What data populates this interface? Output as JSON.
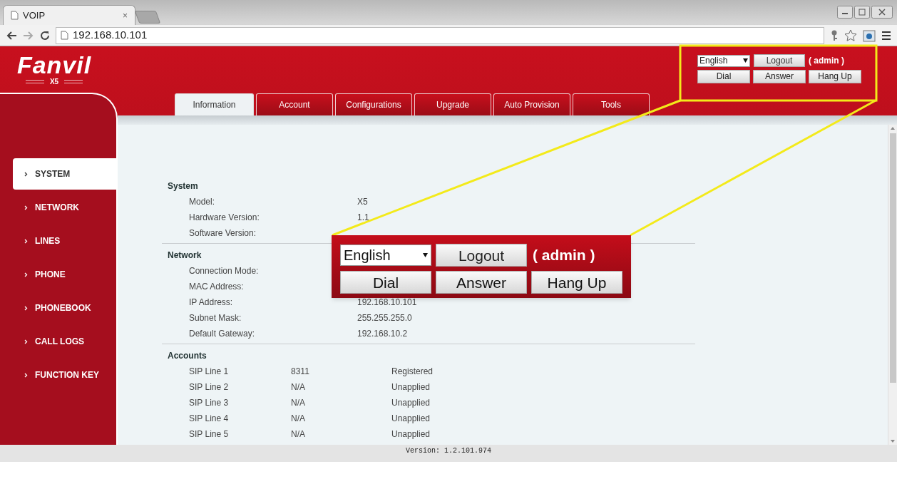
{
  "browser": {
    "tab_title": "VOIP",
    "tab_close": "×",
    "url": "192.168.10.101"
  },
  "header": {
    "logo": "Fanvil",
    "model": "X5",
    "language": "English",
    "logout": "Logout",
    "user": "( admin )",
    "buttons": [
      "Dial",
      "Answer",
      "Hang Up"
    ]
  },
  "tabs": [
    {
      "label": "Information",
      "selected": true
    },
    {
      "label": "Account",
      "selected": false
    },
    {
      "label": "Configurations",
      "selected": false
    },
    {
      "label": "Upgrade",
      "selected": false
    },
    {
      "label": "Auto Provision",
      "selected": false
    },
    {
      "label": "Tools",
      "selected": false
    }
  ],
  "sidebar": {
    "items": [
      {
        "label": "SYSTEM",
        "selected": true
      },
      {
        "label": "NETWORK",
        "selected": false
      },
      {
        "label": "LINES",
        "selected": false
      },
      {
        "label": "PHONE",
        "selected": false
      },
      {
        "label": "PHONEBOOK",
        "selected": false
      },
      {
        "label": "CALL LOGS",
        "selected": false
      },
      {
        "label": "FUNCTION KEY",
        "selected": false
      }
    ]
  },
  "sections": [
    {
      "title": "System",
      "rows": [
        {
          "label": "Model:",
          "value": "X5"
        },
        {
          "label": "Hardware Version:",
          "value": "1.1"
        },
        {
          "label": "Software Version:"
        }
      ]
    },
    {
      "title": "Network",
      "rows": [
        {
          "label": "Connection Mode:"
        },
        {
          "label": "MAC Address:"
        },
        {
          "label": "IP Address:",
          "value": "192.168.10.101"
        },
        {
          "label": "Subnet Mask:",
          "value": "255.255.255.0"
        },
        {
          "label": "Default Gateway:",
          "value": "192.168.10.2"
        }
      ]
    },
    {
      "title": "Accounts",
      "rows": [
        {
          "label": "SIP Line 1",
          "number": "8311",
          "value": "Registered"
        },
        {
          "label": "SIP Line 2",
          "number": "N/A",
          "value": "Unapplied"
        },
        {
          "label": "SIP Line 3",
          "number": "N/A",
          "value": "Unapplied"
        },
        {
          "label": "SIP Line 4",
          "number": "N/A",
          "value": "Unapplied"
        },
        {
          "label": "SIP Line 5",
          "number": "N/A",
          "value": "Unapplied"
        }
      ]
    }
  ],
  "callout": {
    "language": "English",
    "logout": "Logout",
    "user": "( admin )",
    "buttons": [
      "Dial",
      "Answer",
      "Hang Up"
    ]
  },
  "footer": {
    "version": "Version: 1.2.101.974"
  }
}
